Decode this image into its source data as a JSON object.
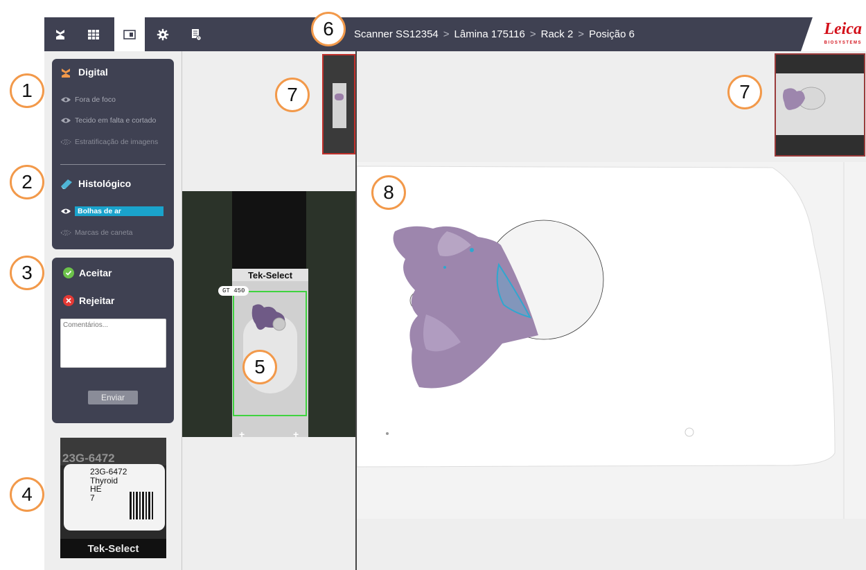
{
  "toolbar": {
    "tabs": [
      {
        "name": "digital-qc-icon",
        "active": false
      },
      {
        "name": "grid-view-icon",
        "active": false
      },
      {
        "name": "slide-view-icon",
        "active": true
      },
      {
        "name": "settings-gear-icon",
        "active": false
      },
      {
        "name": "report-icon",
        "active": false
      }
    ]
  },
  "breadcrumb": {
    "scanner": "Scanner SS12354",
    "slide": "Lâmina 175116",
    "rack": "Rack 2",
    "position": "Posição 6",
    "separator": ">"
  },
  "brand": {
    "word": "Leica",
    "sub": "BIOSYSTEMS",
    "color": "#d3101a"
  },
  "digital": {
    "title": "Digital",
    "options": [
      {
        "label": "Fora de foco",
        "state": "visible"
      },
      {
        "label": "Tecido em falta e cortado",
        "state": "visible"
      },
      {
        "label": "Estratificação de imagens",
        "state": "hidden"
      }
    ]
  },
  "histologic": {
    "title": "Histológico",
    "options": [
      {
        "label": "Bolhas de ar",
        "state": "selected"
      },
      {
        "label": "Marcas de caneta",
        "state": "hidden"
      }
    ]
  },
  "review": {
    "accept": "Aceitar",
    "reject": "Rejeitar",
    "comments_placeholder": "Comentários...",
    "send": "Enviar"
  },
  "slide_label": {
    "lines": [
      "23G-6472",
      "Thyroid",
      "HE",
      "7"
    ],
    "top_text": "23G-6472",
    "brand": "Tek-Select"
  },
  "macro": {
    "strip_text": "Tek-Select",
    "gt_badge": "GT 450"
  },
  "callouts": [
    "1",
    "2",
    "3",
    "4",
    "5",
    "6",
    "7",
    "7",
    "8"
  ],
  "colors": {
    "toolbar_bg": "#3f4152",
    "accent_orange": "#f2994a",
    "selection_blue": "#1aa3cc",
    "accept_green": "#6cc24a",
    "reject_red": "#e53935",
    "scan_box_green": "#3fd33f"
  }
}
